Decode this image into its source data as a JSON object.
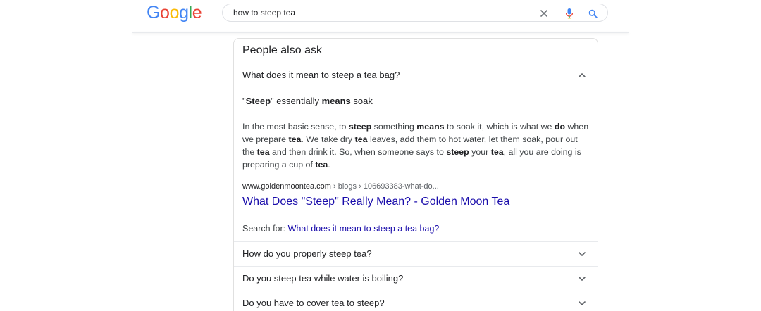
{
  "header": {
    "logo": {
      "letters": [
        "G",
        "o",
        "o",
        "g",
        "l",
        "e"
      ],
      "colors": [
        "#4285f4",
        "#ea4335",
        "#fbbc05",
        "#4285f4",
        "#34a853",
        "#ea4335"
      ]
    },
    "search": {
      "query": "how to steep tea"
    },
    "icons": {
      "clear": "close-icon",
      "voice": "mic-icon",
      "search": "magnifier-icon"
    }
  },
  "paa": {
    "title": "People also ask",
    "expanded": {
      "question": "What does it mean to steep a tea bag?",
      "heading_parts": [
        "\"",
        "Steep",
        "\" essentially ",
        "means",
        " soak"
      ],
      "paragraph_parts": [
        "In the most basic sense, to ",
        "steep",
        " something ",
        "means",
        " to soak it, which is what we ",
        "do",
        " when we prepare ",
        "tea",
        ". We take dry ",
        "tea",
        " leaves, add them to hot water, let them soak, pour out the ",
        "tea",
        " and then drink it. So, when someone says to ",
        "steep",
        " your ",
        "tea",
        ", all you are doing is preparing a cup of ",
        "tea",
        "."
      ],
      "cite_domain": "www.goldenmoontea.com",
      "cite_path": " › blogs › 106693383-what-do...",
      "link_title": "What Does \"Steep\" Really Mean? - Golden Moon Tea",
      "search_for_label": "Search for: ",
      "search_for_query": "What does it mean to steep a tea bag?"
    },
    "questions": [
      "How do you properly steep tea?",
      "Do you steep tea while water is boiling?",
      "Do you have to cover tea to steep?"
    ]
  },
  "colors": {
    "link": "#1a0dab",
    "text": "#202124",
    "secondary_text": "#5f6368",
    "mic_blue": "#4285f4"
  }
}
